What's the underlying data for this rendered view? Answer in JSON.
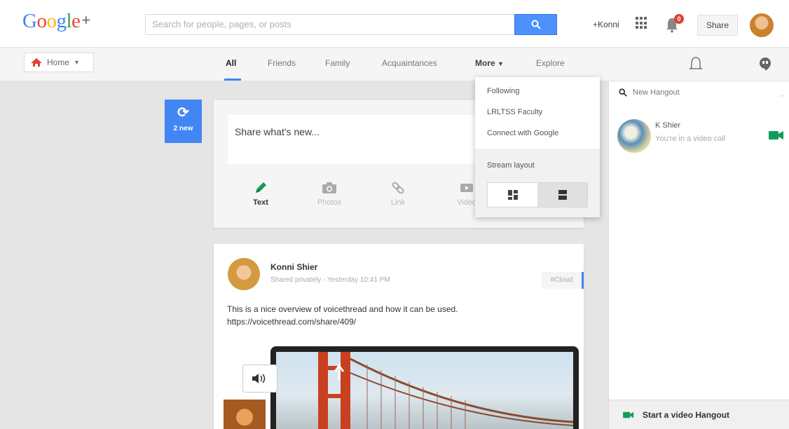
{
  "header": {
    "logo_text": "Google",
    "logo_plus": "+",
    "search_placeholder": "Search for people, pages, or posts",
    "user_name": "+Konni",
    "notification_count": "0",
    "share_label": "Share"
  },
  "nav": {
    "home_label": "Home",
    "tabs": [
      "All",
      "Friends",
      "Family",
      "Acquaintances",
      "More",
      "Explore"
    ]
  },
  "new_posts": {
    "count_label": "2 new"
  },
  "share_box": {
    "prompt": "Share what's new...",
    "options": [
      "Text",
      "Photos",
      "Link",
      "Video"
    ]
  },
  "more_menu": {
    "items": [
      "Following",
      "LRLTSS Faculty",
      "Connect with Google"
    ],
    "layout_label": "Stream layout"
  },
  "hangouts": {
    "search_label": "New Hangout",
    "contact_name": "K Shier",
    "contact_status": "You're in a video call",
    "footer_label": "Start a video Hangout"
  },
  "post": {
    "author": "Konni Shier",
    "meta": "Shared privately  -  Yesterday 10:41 PM",
    "badge": "#Cloud",
    "text_line1": "This is a nice overview of voicethread and how it can be used.",
    "text_line2": "https://voicethread.com/share/409/"
  },
  "colors": {
    "accent": "#4285f4",
    "badge_red": "#db4437",
    "video_green": "#0f9d58"
  }
}
